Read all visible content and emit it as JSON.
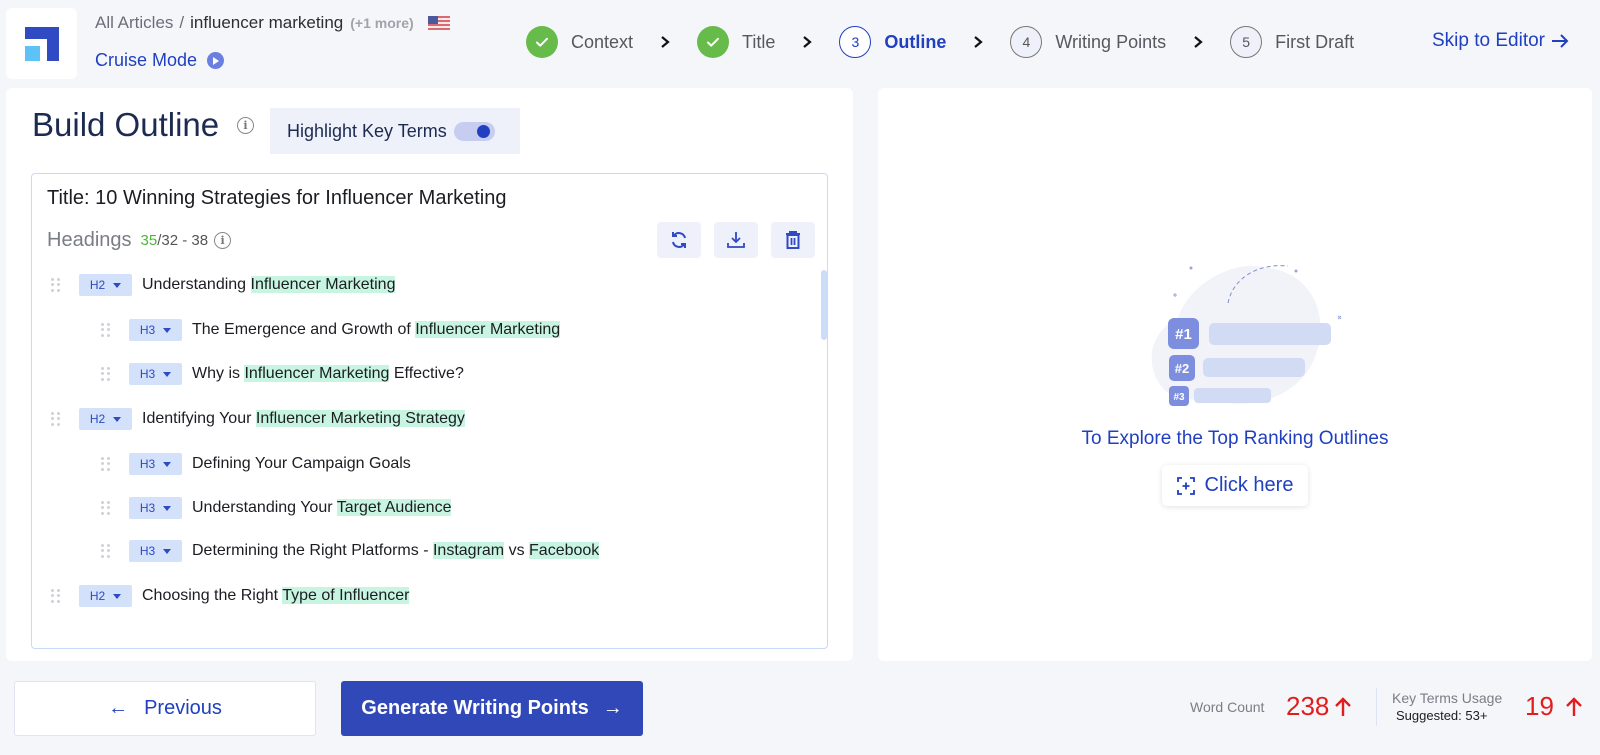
{
  "header": {
    "breadcrumb_root": "All Articles",
    "breadcrumb_sep": "/",
    "keyword": "influencer marketing",
    "more": "(+1 more)",
    "country_flag_icon": "us-flag-icon",
    "cruise_mode": "Cruise Mode",
    "skip_to_editor": "Skip to Editor"
  },
  "steps": [
    {
      "num": "1",
      "label": "Context",
      "state": "done"
    },
    {
      "num": "2",
      "label": "Title",
      "state": "done"
    },
    {
      "num": "3",
      "label": "Outline",
      "state": "active"
    },
    {
      "num": "4",
      "label": "Writing Points",
      "state": "todo"
    },
    {
      "num": "5",
      "label": "First Draft",
      "state": "todo"
    }
  ],
  "outline_panel": {
    "title": "Build Outline",
    "highlight_label": "Highlight Key Terms",
    "highlight_enabled": true,
    "article_title": "Title: 10 Winning Strategies for Influencer Marketing",
    "headings_label": "Headings",
    "headings_count": "35",
    "headings_range": "/32 - 38",
    "tools": [
      "refresh-icon",
      "download-icon",
      "trash-icon"
    ],
    "headings": [
      {
        "level": "H2",
        "parts": [
          {
            "t": "Understanding "
          },
          {
            "t": "Influencer Marketing",
            "hl": true
          }
        ]
      },
      {
        "level": "H3",
        "parts": [
          {
            "t": "The Emergence and Growth of "
          },
          {
            "t": "Influencer Marketing",
            "hl": true
          }
        ]
      },
      {
        "level": "H3",
        "parts": [
          {
            "t": "Why is "
          },
          {
            "t": "Influencer Marketing",
            "hl": true
          },
          {
            "t": " Effective?"
          }
        ]
      },
      {
        "level": "H2",
        "parts": [
          {
            "t": "Identifying Your "
          },
          {
            "t": "Influencer Marketing Strategy",
            "hl": true
          }
        ]
      },
      {
        "level": "H3",
        "parts": [
          {
            "t": "Defining Your Campaign Goals"
          }
        ]
      },
      {
        "level": "H3",
        "parts": [
          {
            "t": "Understanding Your "
          },
          {
            "t": "Target Audience",
            "hl": true
          }
        ]
      },
      {
        "level": "H3",
        "parts": [
          {
            "t": "Determining the Right Platforms - "
          },
          {
            "t": "Instagram",
            "hl": true
          },
          {
            "t": " vs "
          },
          {
            "t": "Facebook",
            "hl": true
          }
        ]
      },
      {
        "level": "H2",
        "parts": [
          {
            "t": "Choosing the Right "
          },
          {
            "t": "Type of Influencer",
            "hl": true
          }
        ]
      }
    ]
  },
  "right_panel": {
    "rank_badges": [
      "#1",
      "#2",
      "#3"
    ],
    "explore_text": "To Explore the Top Ranking Outlines",
    "click_here": "Click here"
  },
  "footer": {
    "previous": "Previous",
    "generate": "Generate Writing Points",
    "word_count_label": "Word Count",
    "word_count_value": "238",
    "key_terms_label": "Key Terms Usage",
    "key_terms_suggested": "Suggested: 53+",
    "key_terms_value": "19"
  },
  "colors": {
    "accent": "#2040c0",
    "primary_button": "#3149b8",
    "done_green": "#66bb4a",
    "highlight": "#c8f5e2",
    "warning_red": "#e21d1d"
  }
}
